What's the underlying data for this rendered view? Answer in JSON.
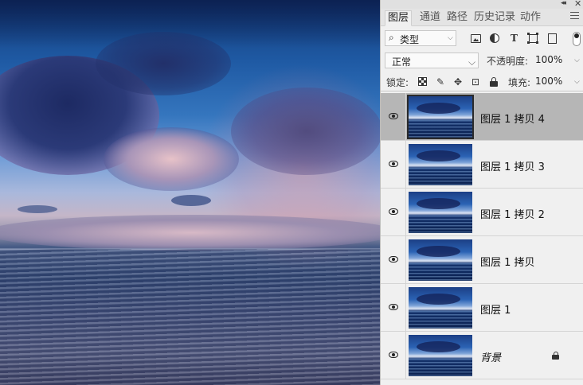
{
  "panel": {
    "tabs": [
      {
        "label": "图层",
        "active": true
      },
      {
        "label": "通道",
        "active": false
      },
      {
        "label": "路径",
        "active": false
      },
      {
        "label": "历史记录",
        "active": false
      },
      {
        "label": "动作",
        "active": false
      }
    ],
    "filter": {
      "kind_label": "类型",
      "icons": [
        "image-filter-icon",
        "adjustment-filter-icon",
        "type-filter-icon",
        "shape-filter-icon",
        "smart-object-filter-icon"
      ],
      "type_glyph": "T"
    },
    "blend_mode": "正常",
    "opacity_label": "不透明度:",
    "opacity_value": "100%",
    "lock_label": "锁定:",
    "fill_label": "填充:",
    "fill_value": "100%"
  },
  "layers": [
    {
      "name": "图层 1 拷贝 4",
      "visible": true,
      "selected": true,
      "locked": false
    },
    {
      "name": "图层 1 拷贝 3",
      "visible": true,
      "selected": false,
      "locked": false
    },
    {
      "name": "图层 1 拷贝 2",
      "visible": true,
      "selected": false,
      "locked": false
    },
    {
      "name": "图层 1 拷贝",
      "visible": true,
      "selected": false,
      "locked": false
    },
    {
      "name": "图层 1",
      "visible": true,
      "selected": false,
      "locked": false
    },
    {
      "name": "背景",
      "visible": true,
      "selected": false,
      "locked": true
    }
  ],
  "colors": {
    "panel_bg": "#f0f0f0",
    "selected_row": "#b6b6b6",
    "accent_text": "#222222"
  }
}
